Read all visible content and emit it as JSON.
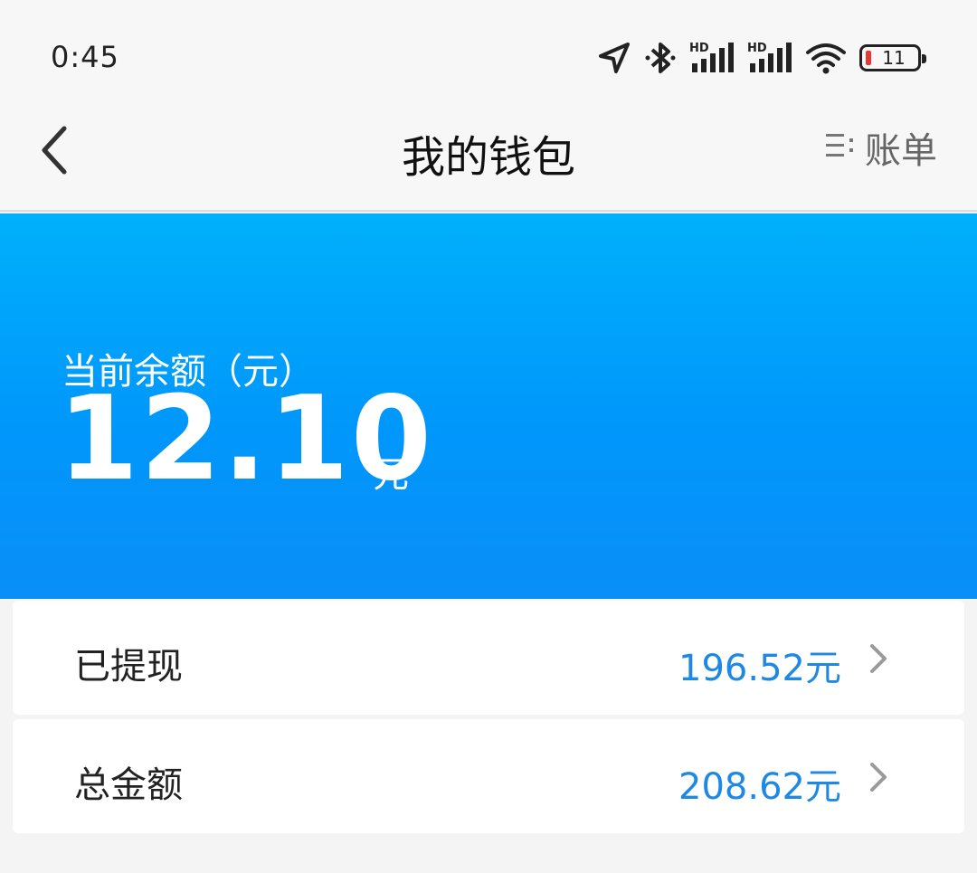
{
  "status_bar": {
    "time": "0:45",
    "battery_level": "11",
    "icons": [
      "location-arrow-icon",
      "bluetooth-icon",
      "hd-signal-icon",
      "hd-signal-icon",
      "wifi-icon",
      "battery-icon"
    ],
    "network_badges": [
      "HD",
      "HD"
    ]
  },
  "nav": {
    "title": "我的钱包",
    "back_icon": "chevron-left-icon",
    "bill_icon": "list-icon",
    "bill_label": "账单"
  },
  "wallet": {
    "balance_label": "当前余额（元）",
    "balance_value": "12.10",
    "balance_unit": "元",
    "hero_color": "#0097fb"
  },
  "rows": [
    {
      "label": "已提现",
      "value": "196.52元"
    },
    {
      "label": "总金额",
      "value": "208.62元"
    }
  ],
  "colors": {
    "accent": "#1e88e5",
    "battery_low": "#e53935"
  }
}
